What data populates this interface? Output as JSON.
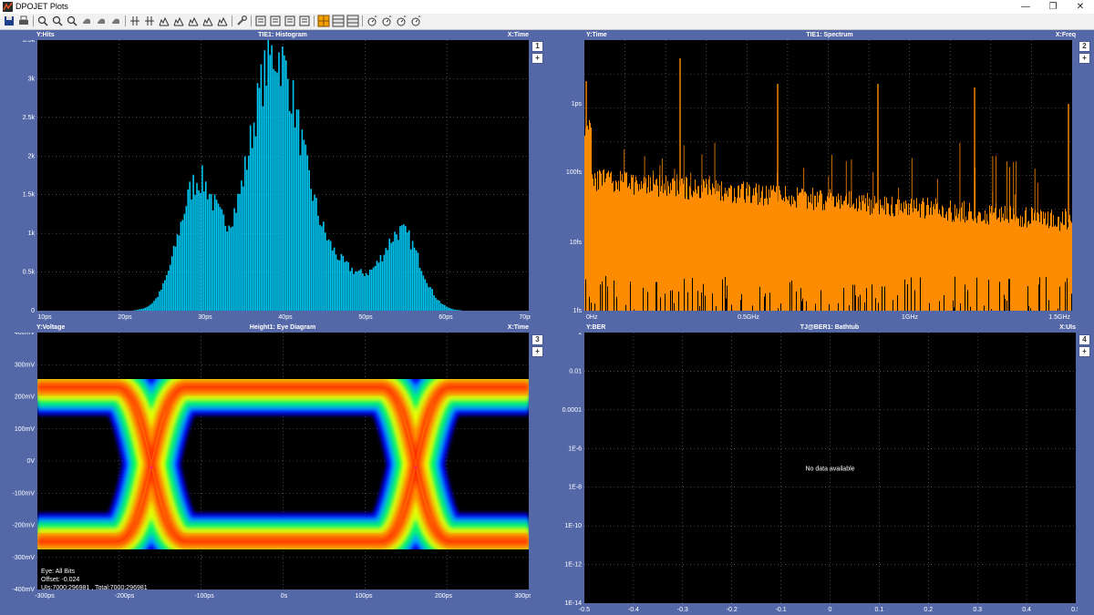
{
  "window": {
    "title": "DPOJET Plots",
    "buttons": {
      "minimize": "—",
      "restore": "❐",
      "close": "✕"
    }
  },
  "toolbar": {
    "icons": [
      "save-icon",
      "print-icon",
      "zoom-icon",
      "zoom-in-icon",
      "zoom-out-icon",
      "pan-icon",
      "pan-left-icon",
      "pan-right-icon",
      "cursor-vertical-icon",
      "cursor-horizontal-icon",
      "marker-1-icon",
      "marker-2-icon",
      "marker-3-icon",
      "marker-4-icon",
      "marker-5-icon",
      "settings-wrench-icon",
      "table-icon",
      "histogram-icon",
      "export-icon",
      "monitor-icon",
      "layout-grid-icon",
      "layout-rows-icon",
      "layout-split-icon",
      "timer-1-icon",
      "timer-2-icon",
      "timer-3-icon",
      "timer-4-icon"
    ]
  },
  "panels": {
    "histogram": {
      "title": "TIE1: Histogram",
      "y_axis_label": "Y:Hits",
      "x_axis_label": "X:Time",
      "side_buttons": [
        "1",
        "+"
      ],
      "y_ticks": [
        "3.5k",
        "3k",
        "2.5k",
        "2k",
        "1.5k",
        "1k",
        "0.5k",
        "0"
      ],
      "x_ticks": [
        "10ps",
        "20ps",
        "30ps",
        "40ps",
        "50ps",
        "60ps",
        "70ps"
      ]
    },
    "spectrum": {
      "title": "TIE1: Spectrum",
      "y_axis_label": "Y:Time",
      "x_axis_label": "X:Freq",
      "side_buttons": [
        "2",
        "+"
      ],
      "y_ticks": [
        "1ps",
        "100fs",
        "10fs",
        "1fs"
      ],
      "x_ticks": [
        "0Hz",
        "0.5GHz",
        "1GHz",
        "1.5GHz"
      ]
    },
    "eye": {
      "title": "Height1: Eye Diagram",
      "y_axis_label": "Y:Voltage",
      "x_axis_label": "X:Time",
      "side_buttons": [
        "3",
        "+"
      ],
      "y_ticks": [
        "400mV",
        "300mV",
        "200mV",
        "100mV",
        "0V",
        "-100mV",
        "-200mV",
        "-300mV",
        "-400mV"
      ],
      "x_ticks": [
        "-300ps",
        "-200ps",
        "-100ps",
        "0s",
        "100ps",
        "200ps",
        "300ps"
      ],
      "info": [
        "Eye: All Bits",
        "Offset: -0.024",
        "UIs:7000:296981 , Total:7000:296981"
      ]
    },
    "bathtub": {
      "title": "TJ@BER1: Bathtub",
      "y_axis_label": "Y:BER",
      "x_axis_label": "X:UIs",
      "side_buttons": [
        "4",
        "+"
      ],
      "y_ticks": [
        "1",
        "0.01",
        "0.0001",
        "1E-6",
        "1E-8",
        "1E-10",
        "1E-12",
        "1E-14"
      ],
      "x_ticks": [
        "-0.5",
        "-0.4",
        "-0.3",
        "-0.2",
        "-0.1",
        "0",
        "0.1",
        "0.2",
        "0.3",
        "0.4",
        "0.5"
      ],
      "message": "No data available"
    }
  },
  "colors": {
    "frame": "#5468a8",
    "plot_bg": "#000000",
    "grid": "#7a7a7a",
    "histogram": "#00c8f4",
    "spectrum": "#ff8c00"
  }
}
